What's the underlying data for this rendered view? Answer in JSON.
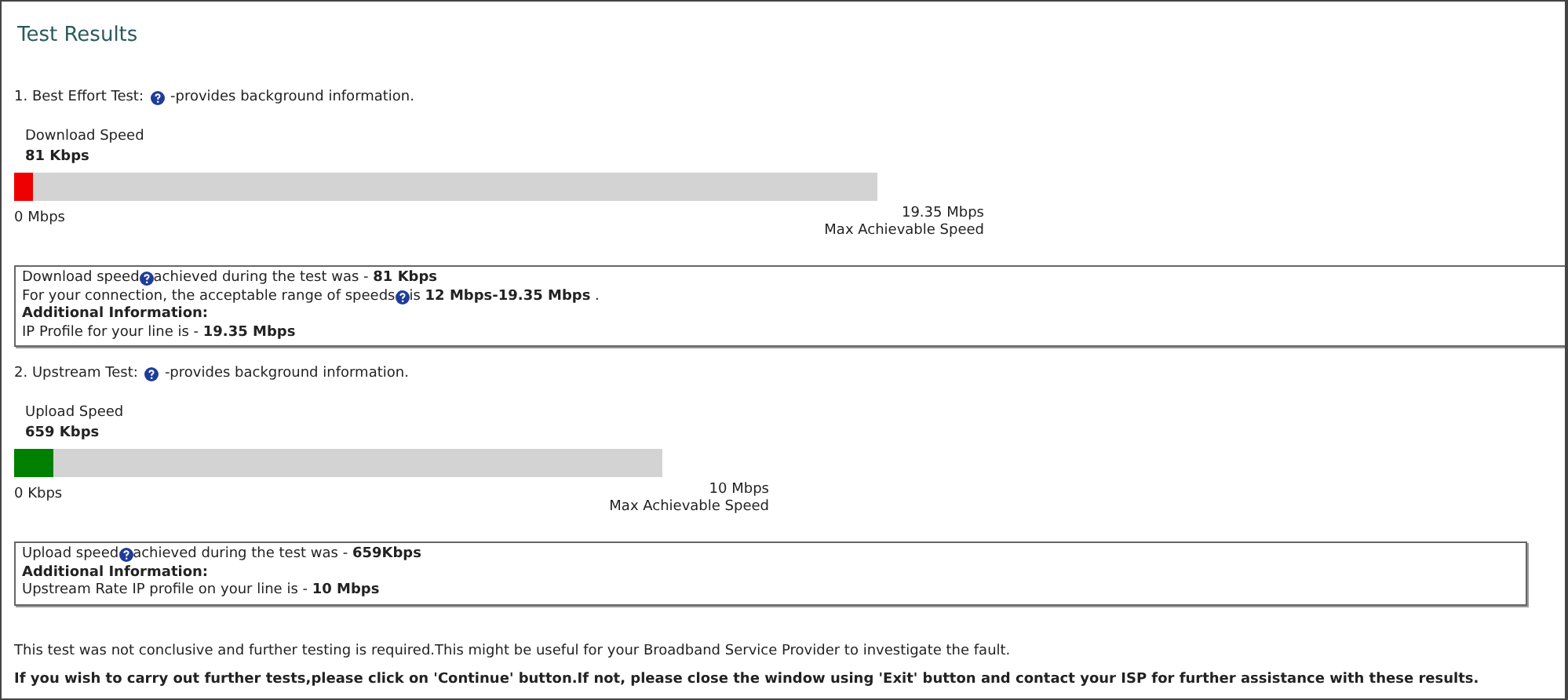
{
  "title": "Test Results",
  "tests": [
    {
      "number": "1.",
      "name": "Best Effort Test:",
      "help_text": "-provides background information.",
      "speed_label": "Download Speed",
      "speed_value": "81 Kbps",
      "level": 0.022,
      "color": "#ee0000",
      "min_label": "0 Mbps",
      "max_label": "19.35 Mbps",
      "max_caption": "Max Achievable Speed",
      "info": [
        {
          "kind": "help",
          "lead": "Download speed",
          "text": "achieved during the test was - **81 Kbps**"
        },
        {
          "kind": "help",
          "lead": "For your connection, the acceptable range of speeds",
          "text": "is **12 Mbps-19.35 Mbps** ."
        },
        {
          "kind": "heading",
          "text": "Additional Information:"
        },
        {
          "kind": "plain",
          "text": "IP Profile for your line is - **19.35 Mbps**"
        }
      ]
    },
    {
      "number": "2.",
      "name": "Upstream Test:",
      "help_text": "-provides background information.",
      "speed_label": "Upload Speed",
      "speed_value": "659 Kbps",
      "level": 0.06,
      "color": "#008000",
      "min_label": "0 Kbps",
      "max_label": "10 Mbps",
      "max_caption": "Max Achievable Speed",
      "info": [
        {
          "kind": "help",
          "lead": "Upload speed",
          "text": " achieved during the test was - **659Kbps**"
        },
        {
          "kind": "heading",
          "text": "Additional Information:"
        },
        {
          "kind": "plain",
          "text": "Upstream Rate IP profile on your line is - **10 Mbps**"
        }
      ]
    }
  ],
  "note": "This test was not conclusive and further testing is required.This might be useful for your Broadband Service Provider to investigate the fault.",
  "instruction": "If you wish to carry out further tests,please click on 'Continue' button.If not, please close the window using 'Exit' button and contact your ISP for further assistance with these results."
}
